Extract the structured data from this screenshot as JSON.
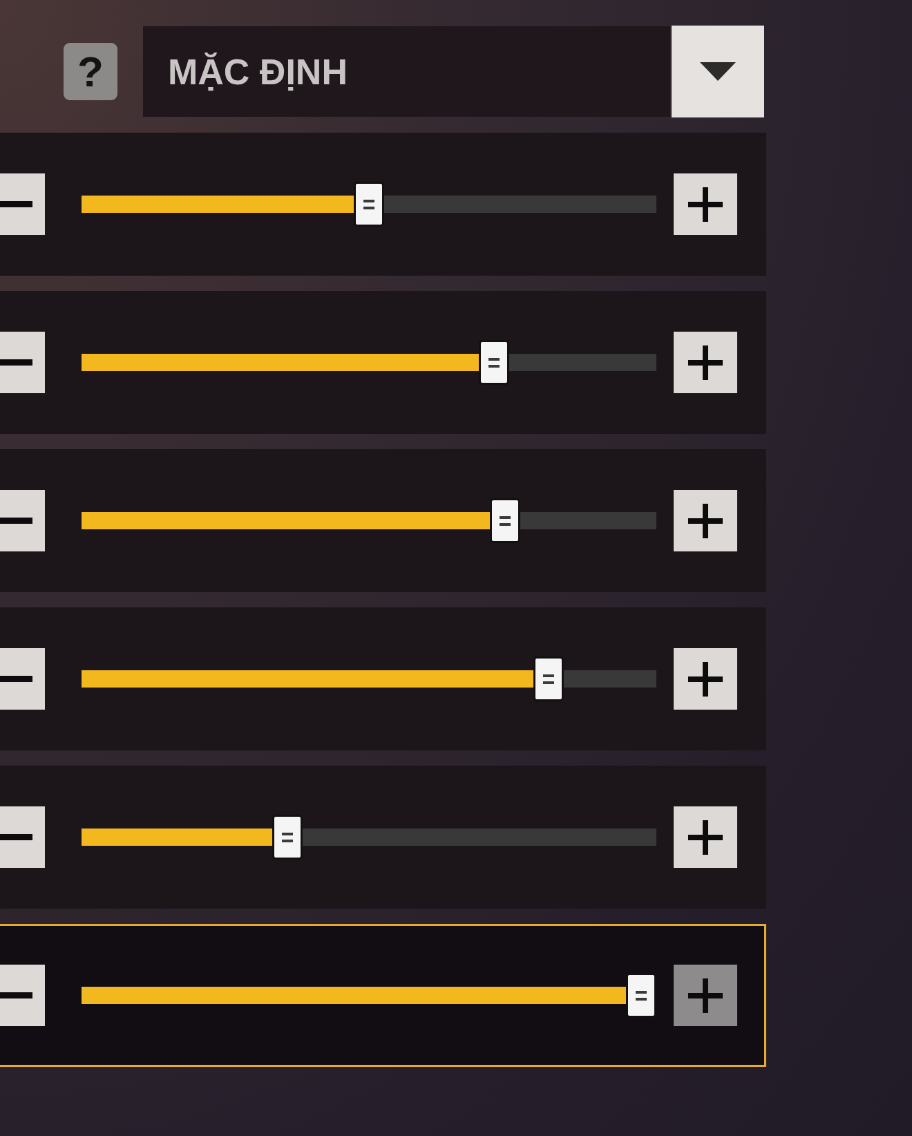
{
  "preset": {
    "help_button": "?",
    "value": "MẶC ĐỊNH"
  },
  "sliders": [
    {
      "level": 0.5,
      "selected": false,
      "plus_disabled": false
    },
    {
      "level": 0.73,
      "selected": false,
      "plus_disabled": false
    },
    {
      "level": 0.75,
      "selected": false,
      "plus_disabled": false
    },
    {
      "level": 0.83,
      "selected": false,
      "plus_disabled": false
    },
    {
      "level": 0.35,
      "selected": false,
      "plus_disabled": false
    },
    {
      "level": 1.0,
      "selected": true,
      "plus_disabled": true
    }
  ]
}
